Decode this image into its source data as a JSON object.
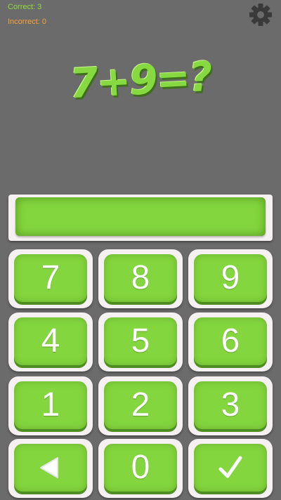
{
  "score": {
    "correct_label": "Correct: 3",
    "incorrect_label": "Incorrect: 0"
  },
  "question": "7+9=?",
  "answer_value": "",
  "keys": {
    "k7": "7",
    "k8": "8",
    "k9": "9",
    "k4": "4",
    "k5": "5",
    "k6": "6",
    "k1": "1",
    "k2": "2",
    "k3": "3",
    "k0": "0"
  },
  "icons": {
    "settings": "gear-icon",
    "backspace": "triangle-left-icon",
    "submit": "checkmark-icon"
  },
  "colors": {
    "background": "#6b6b6b",
    "accent_green": "#84d63e",
    "correct_text": "#8fdc3c",
    "incorrect_text": "#f3a33a"
  }
}
